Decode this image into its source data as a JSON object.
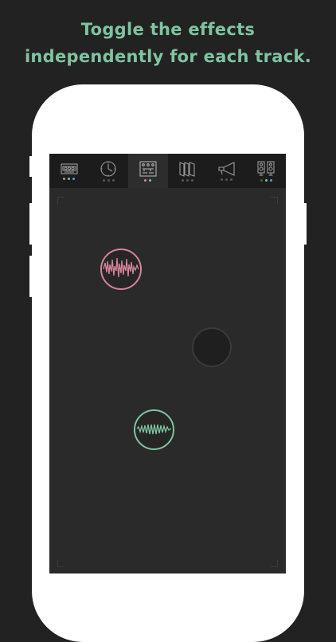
{
  "headline": {
    "line1": "Toggle the effects",
    "line2": "independently for each track."
  },
  "colors": {
    "headline": "#7ec4a0",
    "pink": "#d4859a",
    "teal": "#7ec4a0",
    "blue": "#4fa3d6",
    "icon": "#9a9a9a",
    "inactive_dot": "#555555"
  },
  "toolbar": {
    "tabs": [
      {
        "name": "tape-icon",
        "dots": [
          "pink",
          "teal",
          "blue"
        ],
        "active": false
      },
      {
        "name": "clock-icon",
        "dots": [
          "inactive_dot",
          "inactive_dot",
          "inactive_dot"
        ],
        "active": false
      },
      {
        "name": "circuit-icon",
        "dots": [
          "pink",
          "teal"
        ],
        "active": true
      },
      {
        "name": "panels-icon",
        "dots": [
          "inactive_dot",
          "inactive_dot",
          "inactive_dot"
        ],
        "active": false
      },
      {
        "name": "megaphone-icon",
        "dots": [
          "inactive_dot",
          "inactive_dot",
          "inactive_dot"
        ],
        "active": false
      },
      {
        "name": "speakers-icon",
        "dots": [
          "inactive_dot",
          "teal",
          "blue"
        ],
        "active": false
      }
    ]
  },
  "tracks": [
    {
      "name": "pink-track-node",
      "color": "pink",
      "state": "active",
      "waveform": "noisy"
    },
    {
      "name": "empty-track-node",
      "color": "none",
      "state": "empty",
      "waveform": "none"
    },
    {
      "name": "teal-track-node",
      "color": "teal",
      "state": "active",
      "waveform": "zigzag"
    }
  ]
}
